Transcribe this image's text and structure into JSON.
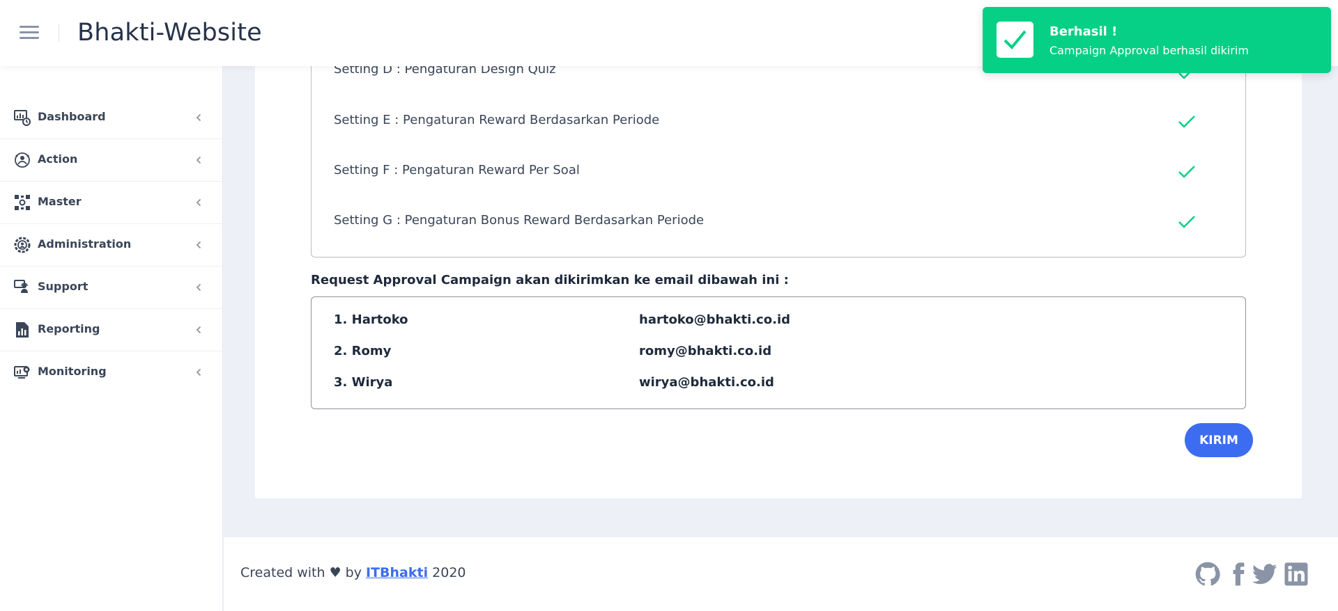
{
  "header": {
    "brand": "Bhakti-Website"
  },
  "sidebar": {
    "items": [
      {
        "label": "Dashboard",
        "icon": "dashboard-icon"
      },
      {
        "label": "Action",
        "icon": "action-icon"
      },
      {
        "label": "Master",
        "icon": "master-icon"
      },
      {
        "label": "Administration",
        "icon": "administration-icon"
      },
      {
        "label": "Support",
        "icon": "support-icon"
      },
      {
        "label": "Reporting",
        "icon": "reporting-icon"
      },
      {
        "label": "Monitoring",
        "icon": "monitoring-icon"
      }
    ]
  },
  "settings": [
    {
      "label": "Setting D : Pengaturan Design Quiz",
      "status": "check-icon"
    },
    {
      "label": "Setting E : Pengaturan Reward Berdasarkan Periode",
      "status": "check-icon"
    },
    {
      "label": "Setting F : Pengaturan Reward Per Soal",
      "status": "check-icon"
    },
    {
      "label": "Setting G : Pengaturan Bonus Reward Berdasarkan Periode",
      "status": "check-icon"
    }
  ],
  "approval": {
    "title": "Request Approval Campaign akan dikirimkan ke email dibawah ini :",
    "recipients": [
      {
        "name": "1. Hartoko",
        "email": "hartoko@bhakti.co.id"
      },
      {
        "name": "2. Romy",
        "email": "romy@bhakti.co.id"
      },
      {
        "name": "3. Wirya",
        "email": "wirya@bhakti.co.id"
      }
    ],
    "submit_label": "KIRIM"
  },
  "footer": {
    "prefix": "Created with ♥ by",
    "link": "ITBhakti",
    "year": "2020",
    "social": [
      "github-icon",
      "facebook-icon",
      "twitter-icon",
      "linkedin-icon"
    ]
  },
  "toast": {
    "title": "Berhasil !",
    "message": "Campaign Approval berhasil dikirim"
  },
  "colors": {
    "accent": "#3c6df0",
    "success": "#05d085",
    "check": "#05d085",
    "background": "#edf0f7"
  }
}
